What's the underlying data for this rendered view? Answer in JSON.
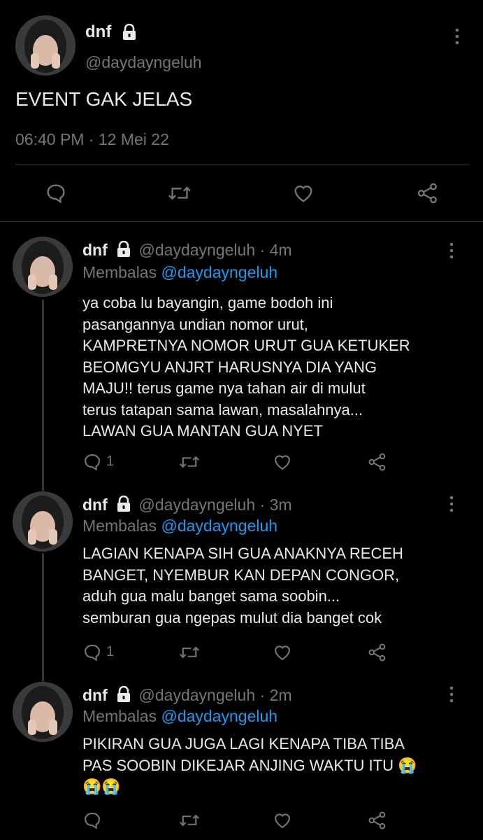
{
  "main": {
    "author": {
      "name": "dnf",
      "handle": "@daydayngeluh"
    },
    "text": "EVENT GAK JELAS",
    "timestamp": "06:40 PM · 12 Mei 22"
  },
  "replies": [
    {
      "name": "dnf",
      "handle": "@daydayngeluh",
      "time": "· 4m",
      "replying_label": "Membalas",
      "replying_to": "@daydayngeluh",
      "text": "ya coba lu bayangin, game bodoh ini\npasangannya undian nomor urut,\nKAMPRETNYA NOMOR URUT GUA KETUKER\nBEOMGYU ANJRT HARUSNYA DIA YANG\nMAJU!! terus game nya tahan air di mulut\nterus tatapan sama lawan, masalahnya...\nLAWAN GUA MANTAN GUA NYET",
      "reply_count": "1"
    },
    {
      "name": "dnf",
      "handle": "@daydayngeluh",
      "time": "· 3m",
      "replying_label": "Membalas",
      "replying_to": "@daydayngeluh",
      "text": "LAGIAN KENAPA SIH GUA ANAKNYA RECEH\nBANGET, NYEMBUR KAN DEPAN CONGOR,\naduh gua malu banget sama soobin...\nsemburan gua ngepas mulut dia banget cok",
      "reply_count": "1"
    },
    {
      "name": "dnf",
      "handle": "@daydayngeluh",
      "time": "· 2m",
      "replying_label": "Membalas",
      "replying_to": "@daydayngeluh",
      "text": "PIKIRAN GUA JUGA LAGI KENAPA TIBA TIBA\nPAS SOOBIN DIKEJAR ANJING WAKTU ITU 😭\n😭😭",
      "reply_count": ""
    }
  ],
  "icons": {
    "reply": "reply-icon",
    "retweet": "retweet-icon",
    "like": "heart-icon",
    "share": "share-icon",
    "lock": "lock-icon",
    "more": "more-vertical-icon"
  },
  "colors": {
    "background": "#000000",
    "text": "#e7e9ea",
    "muted": "#71767b",
    "link": "#1d9bf0",
    "divider": "#2f3336"
  }
}
